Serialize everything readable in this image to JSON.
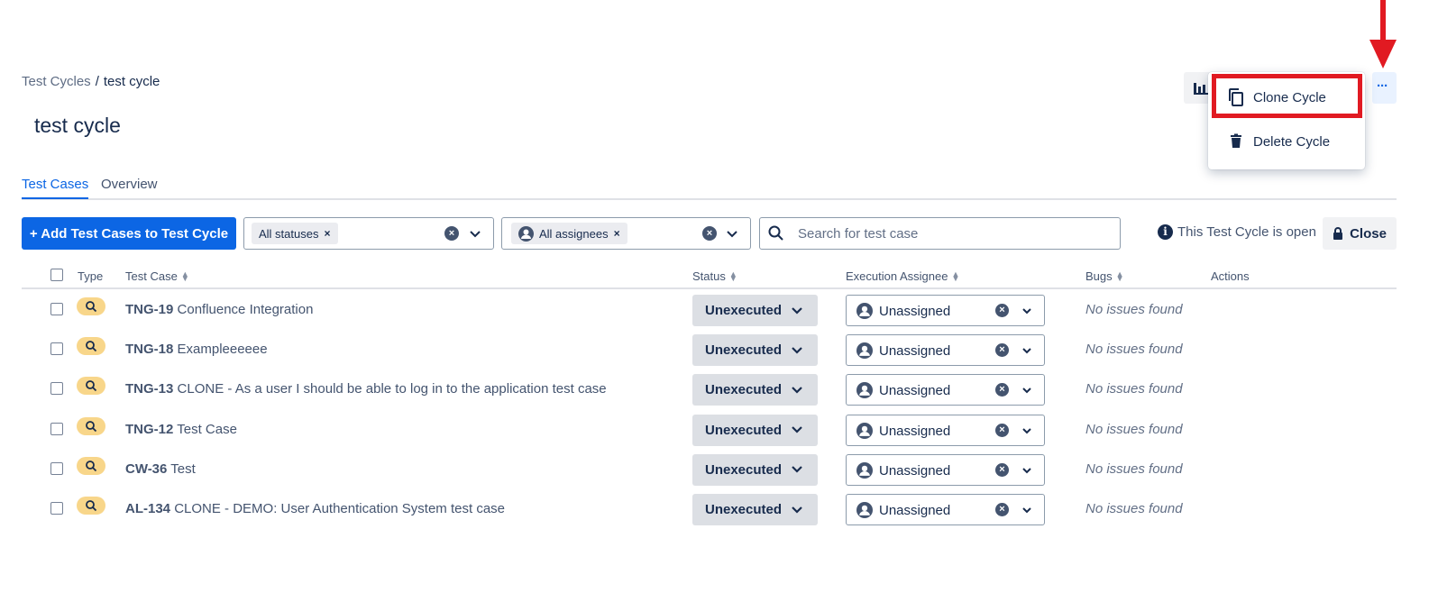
{
  "breadcrumb": {
    "parent": "Test Cycles",
    "separator": "/",
    "current": "test cycle"
  },
  "page_title": "test cycle",
  "tabs": [
    {
      "label": "Test Cases",
      "active": true
    },
    {
      "label": "Overview",
      "active": false
    }
  ],
  "toolbar": {
    "add_button": "+ Add Test Cases to Test Cycle",
    "status_filter": {
      "chip": "All statuses",
      "chip_remove": "×"
    },
    "assignee_filter": {
      "chip": "All assignees",
      "chip_remove": "×"
    },
    "clear_symbol": "×",
    "search_placeholder": "Search for test case",
    "cycle_state_text": "This Test Cycle is open",
    "info_symbol": "i",
    "close_button": "Close"
  },
  "header_actions": {
    "more_label": "···",
    "menu_items": [
      {
        "label": "Clone Cycle",
        "icon": "copy-icon"
      },
      {
        "label": "Delete Cycle",
        "icon": "trash-icon"
      }
    ]
  },
  "table": {
    "columns": {
      "type": "Type",
      "test_case": "Test Case",
      "status": "Status",
      "assignee": "Execution Assignee",
      "bugs": "Bugs",
      "actions": "Actions"
    },
    "rows": [
      {
        "key": "TNG-19",
        "title": "Confluence Integration",
        "status": "Unexecuted",
        "assignee": "Unassigned",
        "bugs": "No issues found"
      },
      {
        "key": "TNG-18",
        "title": "Exampleeeeee",
        "status": "Unexecuted",
        "assignee": "Unassigned",
        "bugs": "No issues found"
      },
      {
        "key": "TNG-13",
        "title": "CLONE - As a user I should be able to log in to the application test case",
        "status": "Unexecuted",
        "assignee": "Unassigned",
        "bugs": "No issues found"
      },
      {
        "key": "TNG-12",
        "title": "Test Case",
        "status": "Unexecuted",
        "assignee": "Unassigned",
        "bugs": "No issues found"
      },
      {
        "key": "CW-36",
        "title": "Test",
        "status": "Unexecuted",
        "assignee": "Unassigned",
        "bugs": "No issues found"
      },
      {
        "key": "AL-134",
        "title": "CLONE - DEMO: User Authentication System test case",
        "status": "Unexecuted",
        "assignee": "Unassigned",
        "bugs": "No issues found"
      }
    ]
  },
  "colors": {
    "primary": "#0c66e4",
    "highlight": "#e11a22",
    "type_badge": "#f8d68a",
    "status_bg": "#dcdfe4"
  }
}
